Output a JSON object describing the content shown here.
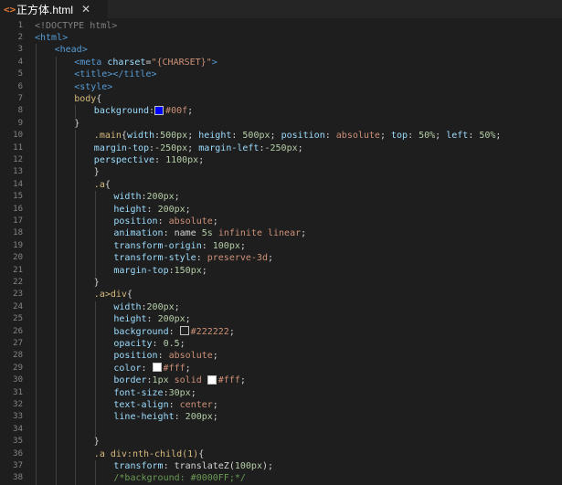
{
  "tab": {
    "icon": "html5-icon",
    "icon_glyph": "<>",
    "title": "正方体.html",
    "close_glyph": "✕"
  },
  "colors": {
    "tag": "#569cd6",
    "attr": "#9cdcfe",
    "value": "#ce9178",
    "selector": "#d7ba7d",
    "text": "#d4d4d4",
    "number": "#b5cea8",
    "comment": "#6a9955",
    "doctype": "#808080"
  },
  "lines": [
    {
      "n": "1",
      "i": 0,
      "t": [
        [
          "d",
          "<!DOCTYPE html>"
        ]
      ]
    },
    {
      "n": "2",
      "i": 0,
      "t": [
        [
          "g",
          "<html>"
        ]
      ]
    },
    {
      "n": "3",
      "i": 1,
      "t": [
        [
          "g",
          "<head>"
        ]
      ]
    },
    {
      "n": "4",
      "i": 2,
      "t": [
        [
          "g",
          "<meta "
        ],
        [
          "a",
          "charset"
        ],
        [
          "r",
          "="
        ],
        [
          "v",
          "\"{CHARSET}\""
        ],
        [
          "g",
          ">"
        ]
      ]
    },
    {
      "n": "5",
      "i": 2,
      "t": [
        [
          "g",
          "<title></title>"
        ]
      ]
    },
    {
      "n": "6",
      "i": 2,
      "t": [
        [
          "g",
          "<style>"
        ]
      ]
    },
    {
      "n": "7",
      "i": 2,
      "t": [
        [
          "p",
          "body"
        ],
        [
          "r",
          "{"
        ]
      ]
    },
    {
      "n": "8",
      "i": 3,
      "t": [
        [
          "a",
          "background"
        ],
        [
          "r",
          ":"
        ],
        [
          "sw",
          "#0000ff"
        ],
        [
          "v",
          "#00f"
        ],
        [
          "r",
          ";"
        ]
      ]
    },
    {
      "n": "9",
      "i": 2,
      "t": [
        [
          "r",
          "}"
        ]
      ]
    },
    {
      "n": "10",
      "i": 3,
      "t": [
        [
          "p",
          ".main"
        ],
        [
          "r",
          "{"
        ],
        [
          "a",
          "width"
        ],
        [
          "r",
          ":"
        ],
        [
          "n",
          "500px"
        ],
        [
          "r",
          "; "
        ],
        [
          "a",
          "height"
        ],
        [
          "r",
          ": "
        ],
        [
          "n",
          "500px"
        ],
        [
          "r",
          "; "
        ],
        [
          "a",
          "position"
        ],
        [
          "r",
          ": "
        ],
        [
          "v",
          "absolute"
        ],
        [
          "r",
          "; "
        ],
        [
          "a",
          "top"
        ],
        [
          "r",
          ": "
        ],
        [
          "n",
          "50%"
        ],
        [
          "r",
          "; "
        ],
        [
          "a",
          "left"
        ],
        [
          "r",
          ": "
        ],
        [
          "n",
          "50%"
        ],
        [
          "r",
          ";"
        ]
      ]
    },
    {
      "n": "11",
      "i": 3,
      "t": [
        [
          "a",
          "margin-top"
        ],
        [
          "r",
          ":"
        ],
        [
          "n",
          "-250px"
        ],
        [
          "r",
          "; "
        ],
        [
          "a",
          "margin-left"
        ],
        [
          "r",
          ":"
        ],
        [
          "n",
          "-250px"
        ],
        [
          "r",
          ";"
        ]
      ]
    },
    {
      "n": "12",
      "i": 3,
      "t": [
        [
          "a",
          "perspective"
        ],
        [
          "r",
          ": "
        ],
        [
          "n",
          "1100px"
        ],
        [
          "r",
          ";"
        ]
      ]
    },
    {
      "n": "13",
      "i": 3,
      "t": [
        [
          "r",
          "}"
        ]
      ]
    },
    {
      "n": "14",
      "i": 3,
      "t": [
        [
          "p",
          ".a"
        ],
        [
          "r",
          "{"
        ]
      ]
    },
    {
      "n": "15",
      "i": 4,
      "t": [
        [
          "a",
          "width"
        ],
        [
          "r",
          ":"
        ],
        [
          "n",
          "200px"
        ],
        [
          "r",
          ";"
        ]
      ]
    },
    {
      "n": "16",
      "i": 4,
      "t": [
        [
          "a",
          "height"
        ],
        [
          "r",
          ": "
        ],
        [
          "n",
          "200px"
        ],
        [
          "r",
          ";"
        ]
      ]
    },
    {
      "n": "17",
      "i": 4,
      "t": [
        [
          "a",
          "position"
        ],
        [
          "r",
          ": "
        ],
        [
          "v",
          "absolute"
        ],
        [
          "r",
          ";"
        ]
      ]
    },
    {
      "n": "18",
      "i": 4,
      "t": [
        [
          "a",
          "animation"
        ],
        [
          "r",
          ": name "
        ],
        [
          "n",
          "5s"
        ],
        [
          "r",
          " "
        ],
        [
          "v",
          "infinite linear"
        ],
        [
          "r",
          ";"
        ]
      ]
    },
    {
      "n": "19",
      "i": 4,
      "t": [
        [
          "a",
          "transform-origin"
        ],
        [
          "r",
          ": "
        ],
        [
          "n",
          "100px"
        ],
        [
          "r",
          ";"
        ]
      ]
    },
    {
      "n": "20",
      "i": 4,
      "t": [
        [
          "a",
          "transform-style"
        ],
        [
          "r",
          ": "
        ],
        [
          "v",
          "preserve-3d"
        ],
        [
          "r",
          ";"
        ]
      ]
    },
    {
      "n": "21",
      "i": 4,
      "t": [
        [
          "a",
          "margin-top"
        ],
        [
          "r",
          ":"
        ],
        [
          "n",
          "150px"
        ],
        [
          "r",
          ";"
        ]
      ]
    },
    {
      "n": "22",
      "i": 3,
      "t": [
        [
          "r",
          "}"
        ]
      ]
    },
    {
      "n": "23",
      "i": 3,
      "t": [
        [
          "p",
          ".a>div"
        ],
        [
          "r",
          "{"
        ]
      ]
    },
    {
      "n": "24",
      "i": 4,
      "t": [
        [
          "a",
          "width"
        ],
        [
          "r",
          ":"
        ],
        [
          "n",
          "200px"
        ],
        [
          "r",
          ";"
        ]
      ]
    },
    {
      "n": "25",
      "i": 4,
      "t": [
        [
          "a",
          "height"
        ],
        [
          "r",
          ": "
        ],
        [
          "n",
          "200px"
        ],
        [
          "r",
          ";"
        ]
      ]
    },
    {
      "n": "26",
      "i": 4,
      "t": [
        [
          "a",
          "background"
        ],
        [
          "r",
          ": "
        ],
        [
          "sw",
          "#222222"
        ],
        [
          "v",
          "#222222"
        ],
        [
          "r",
          ";"
        ]
      ]
    },
    {
      "n": "27",
      "i": 4,
      "t": [
        [
          "a",
          "opacity"
        ],
        [
          "r",
          ": "
        ],
        [
          "n",
          "0.5"
        ],
        [
          "r",
          ";"
        ]
      ]
    },
    {
      "n": "28",
      "i": 4,
      "t": [
        [
          "a",
          "position"
        ],
        [
          "r",
          ": "
        ],
        [
          "v",
          "absolute"
        ],
        [
          "r",
          ";"
        ]
      ]
    },
    {
      "n": "29",
      "i": 4,
      "t": [
        [
          "a",
          "color"
        ],
        [
          "r",
          ": "
        ],
        [
          "sw",
          "#ffffff"
        ],
        [
          "v",
          "#fff"
        ],
        [
          "r",
          ";"
        ]
      ]
    },
    {
      "n": "30",
      "i": 4,
      "t": [
        [
          "a",
          "border"
        ],
        [
          "r",
          ":"
        ],
        [
          "n",
          "1px"
        ],
        [
          "r",
          " "
        ],
        [
          "v",
          "solid "
        ],
        [
          "sw",
          "#ffffff"
        ],
        [
          "v",
          "#fff"
        ],
        [
          "r",
          ";"
        ]
      ]
    },
    {
      "n": "31",
      "i": 4,
      "t": [
        [
          "a",
          "font-size"
        ],
        [
          "r",
          ":"
        ],
        [
          "n",
          "30px"
        ],
        [
          "r",
          ";"
        ]
      ]
    },
    {
      "n": "32",
      "i": 4,
      "t": [
        [
          "a",
          "text-align"
        ],
        [
          "r",
          ": "
        ],
        [
          "v",
          "center"
        ],
        [
          "r",
          ";"
        ]
      ]
    },
    {
      "n": "33",
      "i": 4,
      "t": [
        [
          "a",
          "line-height"
        ],
        [
          "r",
          ": "
        ],
        [
          "n",
          "200px"
        ],
        [
          "r",
          ";"
        ]
      ]
    },
    {
      "n": "34",
      "i": 4,
      "t": []
    },
    {
      "n": "35",
      "i": 3,
      "t": [
        [
          "r",
          "}"
        ]
      ]
    },
    {
      "n": "36",
      "i": 3,
      "t": [
        [
          "p",
          ".a div:nth-child(1)"
        ],
        [
          "r",
          "{"
        ]
      ]
    },
    {
      "n": "37",
      "i": 4,
      "t": [
        [
          "a",
          "transform"
        ],
        [
          "r",
          ": "
        ],
        [
          "r",
          "translateZ("
        ],
        [
          "n",
          "100px"
        ],
        [
          "r",
          ");"
        ]
      ]
    },
    {
      "n": "38",
      "i": 4,
      "t": [
        [
          "c",
          "/*background: #0000FF;*/"
        ]
      ]
    }
  ]
}
